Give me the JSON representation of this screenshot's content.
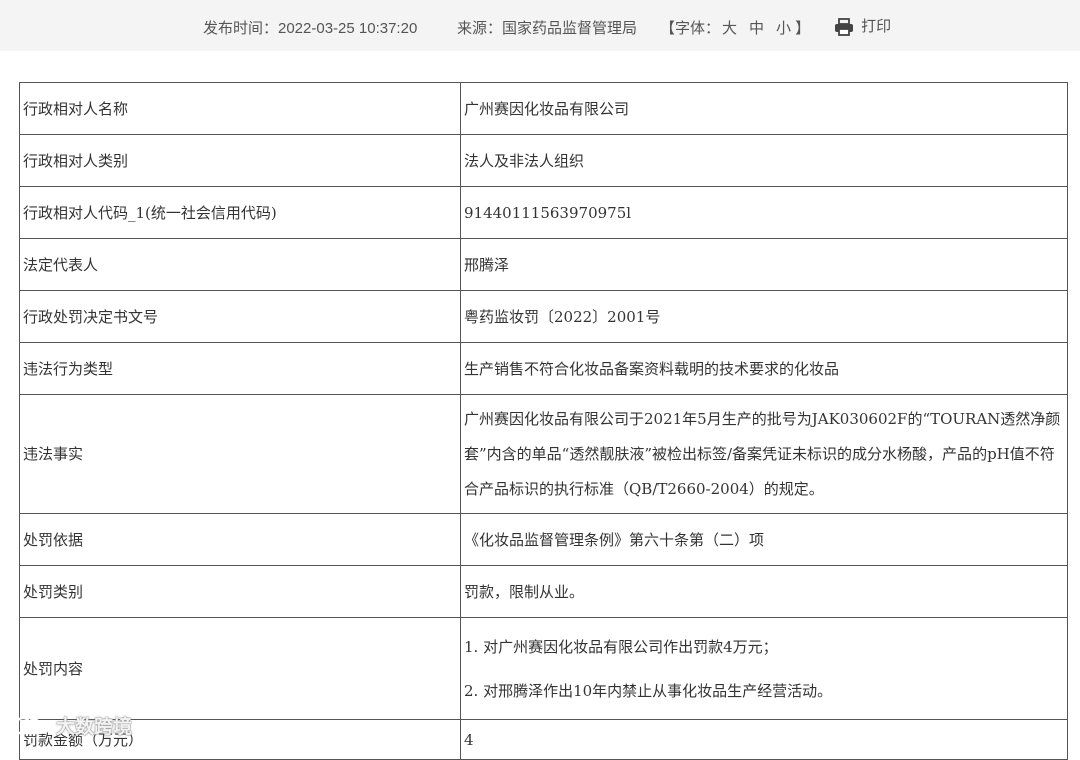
{
  "header": {
    "publish_time": "发布时间：2022-03-25 10:37:20",
    "source": "来源：国家药品监督管理局",
    "font_prefix": "【字体：",
    "font_large": "大",
    "font_medium": "中",
    "font_small": "小",
    "font_suffix": "】",
    "print_label": "打印"
  },
  "rows": [
    {
      "label": "行政相对人名称",
      "value": "广州赛因化妆品有限公司"
    },
    {
      "label": "行政相对人类别",
      "value": "法人及非法人组织"
    },
    {
      "label": "行政相对人代码_1(统一社会信用代码)",
      "value": "91440111563970975l"
    },
    {
      "label": "法定代表人",
      "value": "邢腾泽"
    },
    {
      "label": "行政处罚决定书文号",
      "value": "粤药监妆罚〔2022〕2001号"
    },
    {
      "label": "违法行为类型",
      "value": "生产销售不符合化妆品备案资料载明的技术要求的化妆品"
    },
    {
      "label": "违法事实",
      "value": "广州赛因化妆品有限公司于2021年5月生产的批号为JAK030602F的“TOURAN透然净颜套”内含的单品“透然靓肤液”被检出标签/备案凭证未标识的成分水杨酸，产品的pH值不符合产品标识的执行标准（QB/T2660-2004）的规定。"
    },
    {
      "label": "处罚依据",
      "value": "《化妆品监督管理条例》第六十条第（二）项"
    },
    {
      "label": "处罚类别",
      "value": "罚款，限制从业。"
    },
    {
      "label": "处罚内容",
      "value_lines": [
        "1. 对广州赛因化妆品有限公司作出罚款4万元；",
        "2. 对邢腾泽作出10年内禁止从事化妆品生产经营活动。"
      ]
    },
    {
      "label": "罚款金额（万元）",
      "value": "4"
    }
  ],
  "watermark": {
    "text": "大数跨境",
    "icon": "cloud-logo-icon"
  },
  "icons": {
    "print": "printer-icon"
  }
}
